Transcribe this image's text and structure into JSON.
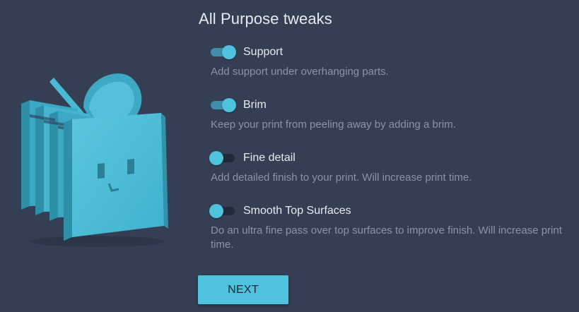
{
  "title": "All Purpose tweaks",
  "illustration": {
    "icon": "cube-mascot-with-heart-icon"
  },
  "options": [
    {
      "label": "Support",
      "description": "Add support under overhanging parts.",
      "enabled": true
    },
    {
      "label": "Brim",
      "description": "Keep your print from peeling away by adding a brim.",
      "enabled": true
    },
    {
      "label": "Fine detail",
      "description": "Add detailed finish to your print. Will increase print time.",
      "enabled": false
    },
    {
      "label": "Smooth Top Surfaces",
      "description": "Do an ultra fine pass over top surfaces to improve finish. Will increase print time.",
      "enabled": false
    }
  ],
  "next_button": {
    "label": "NEXT"
  },
  "colors": {
    "background": "#353f54",
    "accent": "#4fc3de",
    "text": "#e7eaf0",
    "muted_text": "#8a94a8"
  }
}
